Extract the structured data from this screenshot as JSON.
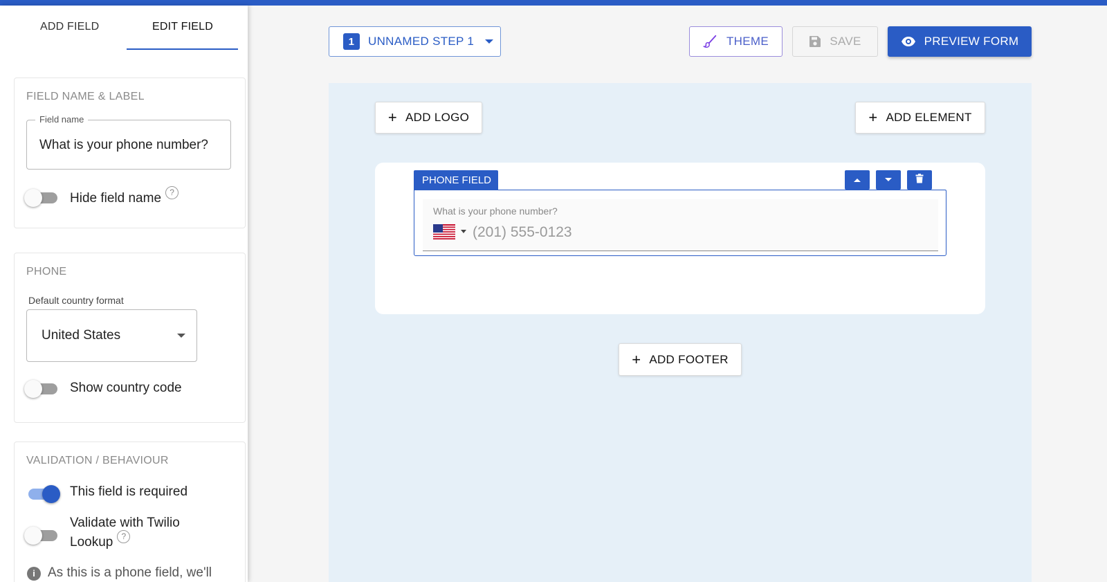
{
  "sidebar": {
    "tabs": {
      "add": "ADD FIELD",
      "edit": "EDIT FIELD"
    },
    "name_card": {
      "title": "FIELD NAME & LABEL",
      "field_name_legend": "Field name",
      "field_name_value": "What is your phone number?",
      "hide_label": "Hide field name",
      "hide_on": false,
      "help": "?"
    },
    "phone_card": {
      "title": "PHONE",
      "country_label": "Default country format",
      "country_value": "United States",
      "show_code_label": "Show country code",
      "show_code_on": false
    },
    "validation_card": {
      "title": "VALIDATION / BEHAVIOUR",
      "required_label": "This field is required",
      "required_on": true,
      "twilio_label_1": "Validate with Twilio",
      "twilio_label_2": "Lookup",
      "twilio_on": false,
      "help": "?",
      "info_icon": "i",
      "info_text": "As this is a phone field, we'll"
    }
  },
  "toolbar": {
    "step_number": "1",
    "step_label": "UNNAMED STEP 1",
    "theme_label": "THEME",
    "save_label": "SAVE",
    "preview_label": "PREVIEW FORM"
  },
  "canvas": {
    "add_logo": "ADD LOGO",
    "add_element": "ADD ELEMENT",
    "add_footer": "ADD FOOTER",
    "plus": "+",
    "field_tag": "PHONE FIELD",
    "phone_label": "What is your phone number?",
    "phone_placeholder": "(201) 555-0123"
  },
  "colors": {
    "accent": "#2a5cc5",
    "canvas_bg": "#e6f0f8",
    "theme_purple": "#7b3fe4"
  },
  "icons": {
    "theme": "brush-icon",
    "save": "floppy-disk-icon",
    "preview": "eye-icon",
    "move_up": "arrow-up-icon",
    "move_down": "arrow-down-icon",
    "delete": "trash-icon",
    "flag": "us-flag-icon"
  }
}
